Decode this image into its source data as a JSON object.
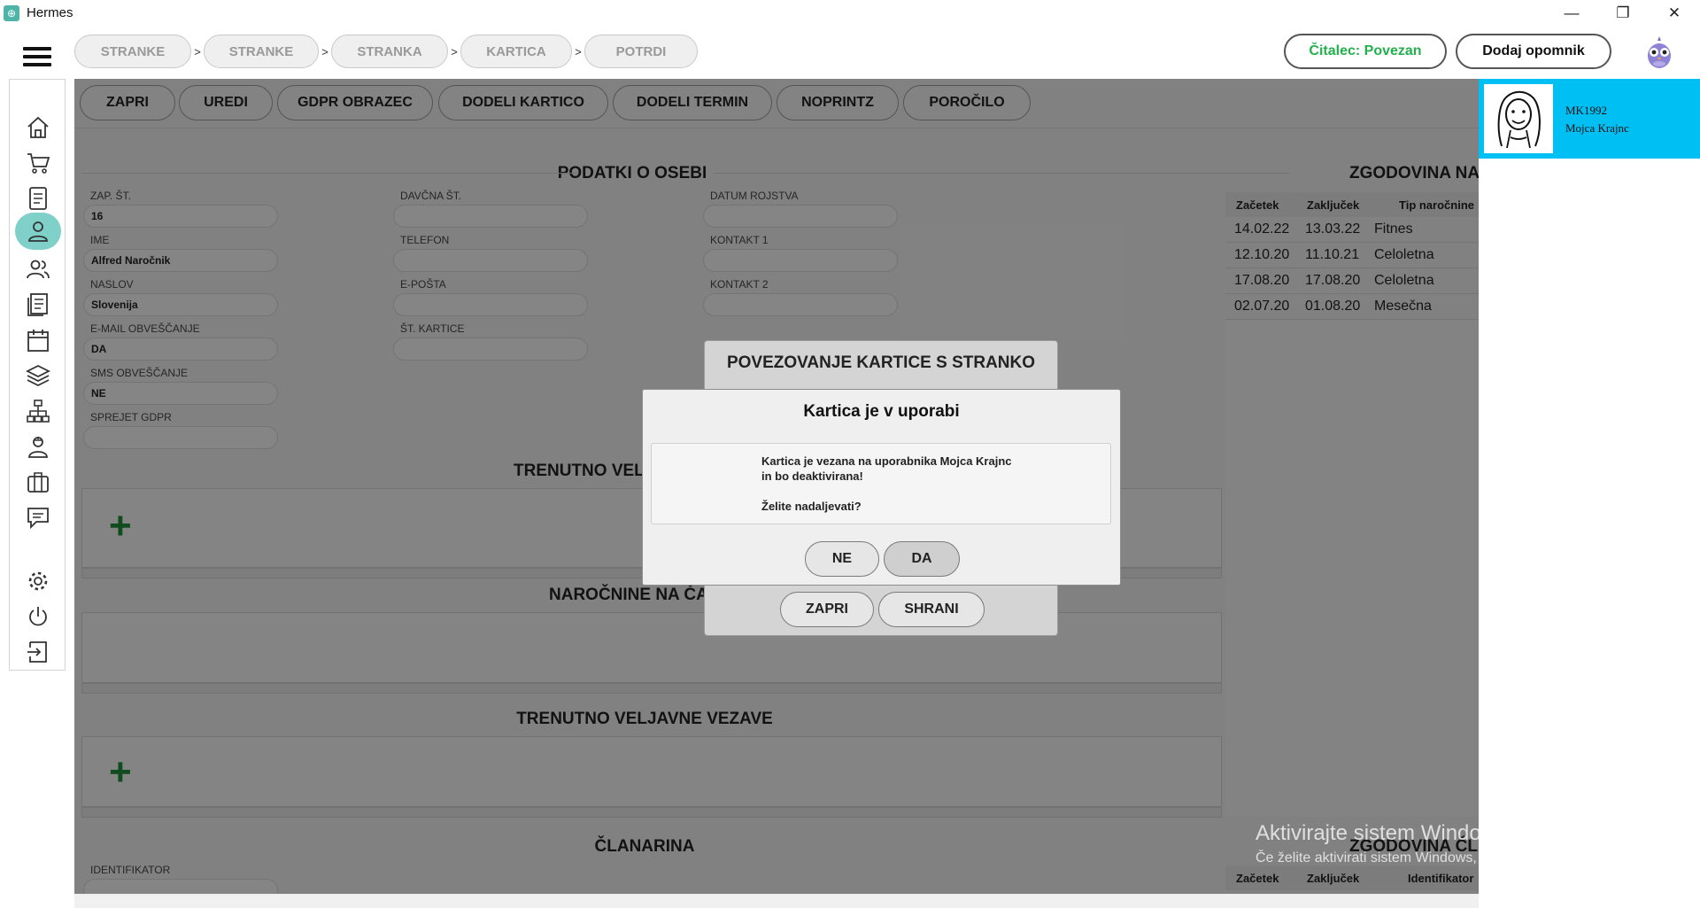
{
  "window": {
    "title": "Hermes",
    "minimize": "—",
    "restore": "❐",
    "close": "✕"
  },
  "breadcrumbs": [
    "STRANKE",
    "STRANKE",
    "STRANKA",
    "KARTICA",
    "POTRDI"
  ],
  "breadcrumb_sep": ">",
  "topbar": {
    "reader_status": "Čitalec: Povezan",
    "add_reminder": "Dodaj opomnik"
  },
  "colors": {
    "accent": "#7fd0c8",
    "reader_green": "#22b14c",
    "user_panel": "#00bff3",
    "plus_green": "#1f8b3a"
  },
  "sidebar_icons": [
    "home-icon",
    "cart-icon",
    "document-icon",
    "user-icon",
    "users-icon",
    "list-icon",
    "calendar-icon",
    "layers-icon",
    "network-icon",
    "staff-icon",
    "briefcase-icon",
    "chat-icon",
    "gear-icon",
    "power-icon",
    "exit-icon"
  ],
  "actions": [
    "ZAPRI",
    "UREDI",
    "GDPR OBRAZEC",
    "DODELI KARTICO",
    "DODELI TERMIN",
    "NOPRINTZ",
    "POROČILO"
  ],
  "person": {
    "title": "PODATKI O OSEBI",
    "fields": {
      "zap_st": {
        "label": "ZAP. ŠT.",
        "value": "16"
      },
      "ime": {
        "label": "IME",
        "value": "Alfred Naročnik"
      },
      "naslov": {
        "label": "NASLOV",
        "value": "Slovenija"
      },
      "email_obv": {
        "label": "E-MAIL OBVEŠČANJE",
        "value": "DA"
      },
      "sms_obv": {
        "label": "SMS OBVEŠČANJE",
        "value": "NE"
      },
      "gdpr": {
        "label": "SPREJET GDPR",
        "value": ""
      },
      "davcna": {
        "label": "DAVČNA ŠT.",
        "value": ""
      },
      "telefon": {
        "label": "TELEFON",
        "value": ""
      },
      "eposta": {
        "label": "E-POŠTA",
        "value": ""
      },
      "st_kartice": {
        "label": "ŠT. KARTICE",
        "value": ""
      },
      "datum_rojstva": {
        "label": "DATUM ROJSTVA",
        "value": ""
      },
      "kontakt1": {
        "label": "KONTAKT 1",
        "value": ""
      },
      "kontakt2": {
        "label": "KONTAKT 2",
        "value": ""
      }
    }
  },
  "sections": {
    "valid": "TRENUTNO VELJ",
    "waiting": "NAROČNINE NA ČAK",
    "bonds": "TRENUTNO VELJAVNE VEZAVE",
    "membership": "ČLANARINA",
    "identifier_label": "IDENTIFIKATOR"
  },
  "history": {
    "title": "ZGODOVINA NA",
    "headers": [
      "Začetek",
      "Zaključek",
      "Tip naročnine"
    ],
    "rows": [
      [
        "14.02.22",
        "13.03.22",
        "Fitnes"
      ],
      [
        "12.10.20",
        "11.10.21",
        "Celoletna"
      ],
      [
        "17.08.20",
        "17.08.20",
        "Celoletna"
      ],
      [
        "02.07.20",
        "01.08.20",
        "Mesečna"
      ]
    ]
  },
  "history2": {
    "title": "ZGODOVINA ČL",
    "headers": [
      "Začetek",
      "Zaključek",
      "Identifikator"
    ]
  },
  "user": {
    "code": "MK1992",
    "name": "Mojca Krajnc"
  },
  "dialog_back": {
    "title": "POVEZOVANJE KARTICE S STRANKO",
    "close": "ZAPRI",
    "save": "SHRANI"
  },
  "dialog_front": {
    "title": "Kartica je v uporabi",
    "line1": "Kartica je vezana na uporabnika Mojca Krajnc",
    "line2": "in bo deaktivirana!",
    "line3": "Želite nadaljevati?",
    "no": "NE",
    "yes": "DA"
  },
  "watermark": {
    "line1": "Aktivirajte sistem Windows",
    "line2": "Če želite aktivirati sistem Windows, odprite nastavitve."
  }
}
